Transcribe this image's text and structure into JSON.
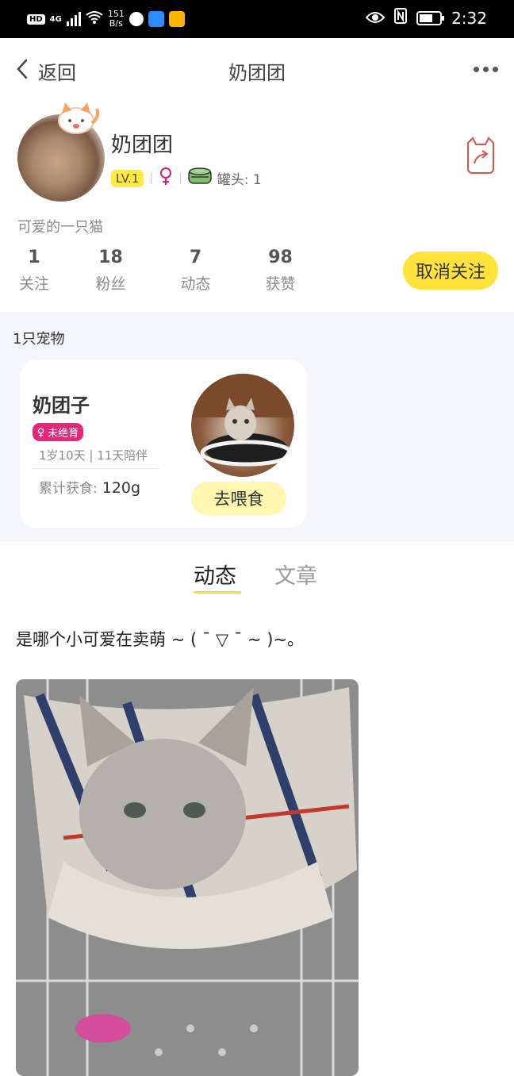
{
  "status_bar": {
    "hd": "HD",
    "network": "4G",
    "speed_value": "151",
    "speed_unit": "B/s",
    "time": "2:32",
    "battery_level": 0.65
  },
  "nav": {
    "back_label": "返回",
    "title": "奶团团"
  },
  "profile": {
    "username": "奶团团",
    "level": "LV.1",
    "cans_label": "罐头: 1",
    "bio": "可爱的一只猫",
    "follow_button": "取消关注",
    "stats": [
      {
        "num": "1",
        "label": "关注"
      },
      {
        "num": "18",
        "label": "粉丝"
      },
      {
        "num": "7",
        "label": "动态"
      },
      {
        "num": "98",
        "label": "获赞"
      }
    ]
  },
  "pets": {
    "count_label": "1只宠物",
    "card": {
      "name": "奶团子",
      "tag": "未绝育",
      "age": "1岁10天 | 11天陪伴",
      "fed_label": "累计获食:",
      "fed_value": "120g",
      "feed_button": "去喂食"
    }
  },
  "tabs": [
    {
      "label": "动态",
      "active": true
    },
    {
      "label": "文章",
      "active": false
    }
  ],
  "post": {
    "text": "是哪个小可爱在卖萌 ~ ( ¯ ▽ ¯ ~ )~。"
  },
  "colors": {
    "accent_yellow": "#ffe33a",
    "tag_pink": "#e5267b",
    "pet_bg": "#f5f6fb"
  }
}
